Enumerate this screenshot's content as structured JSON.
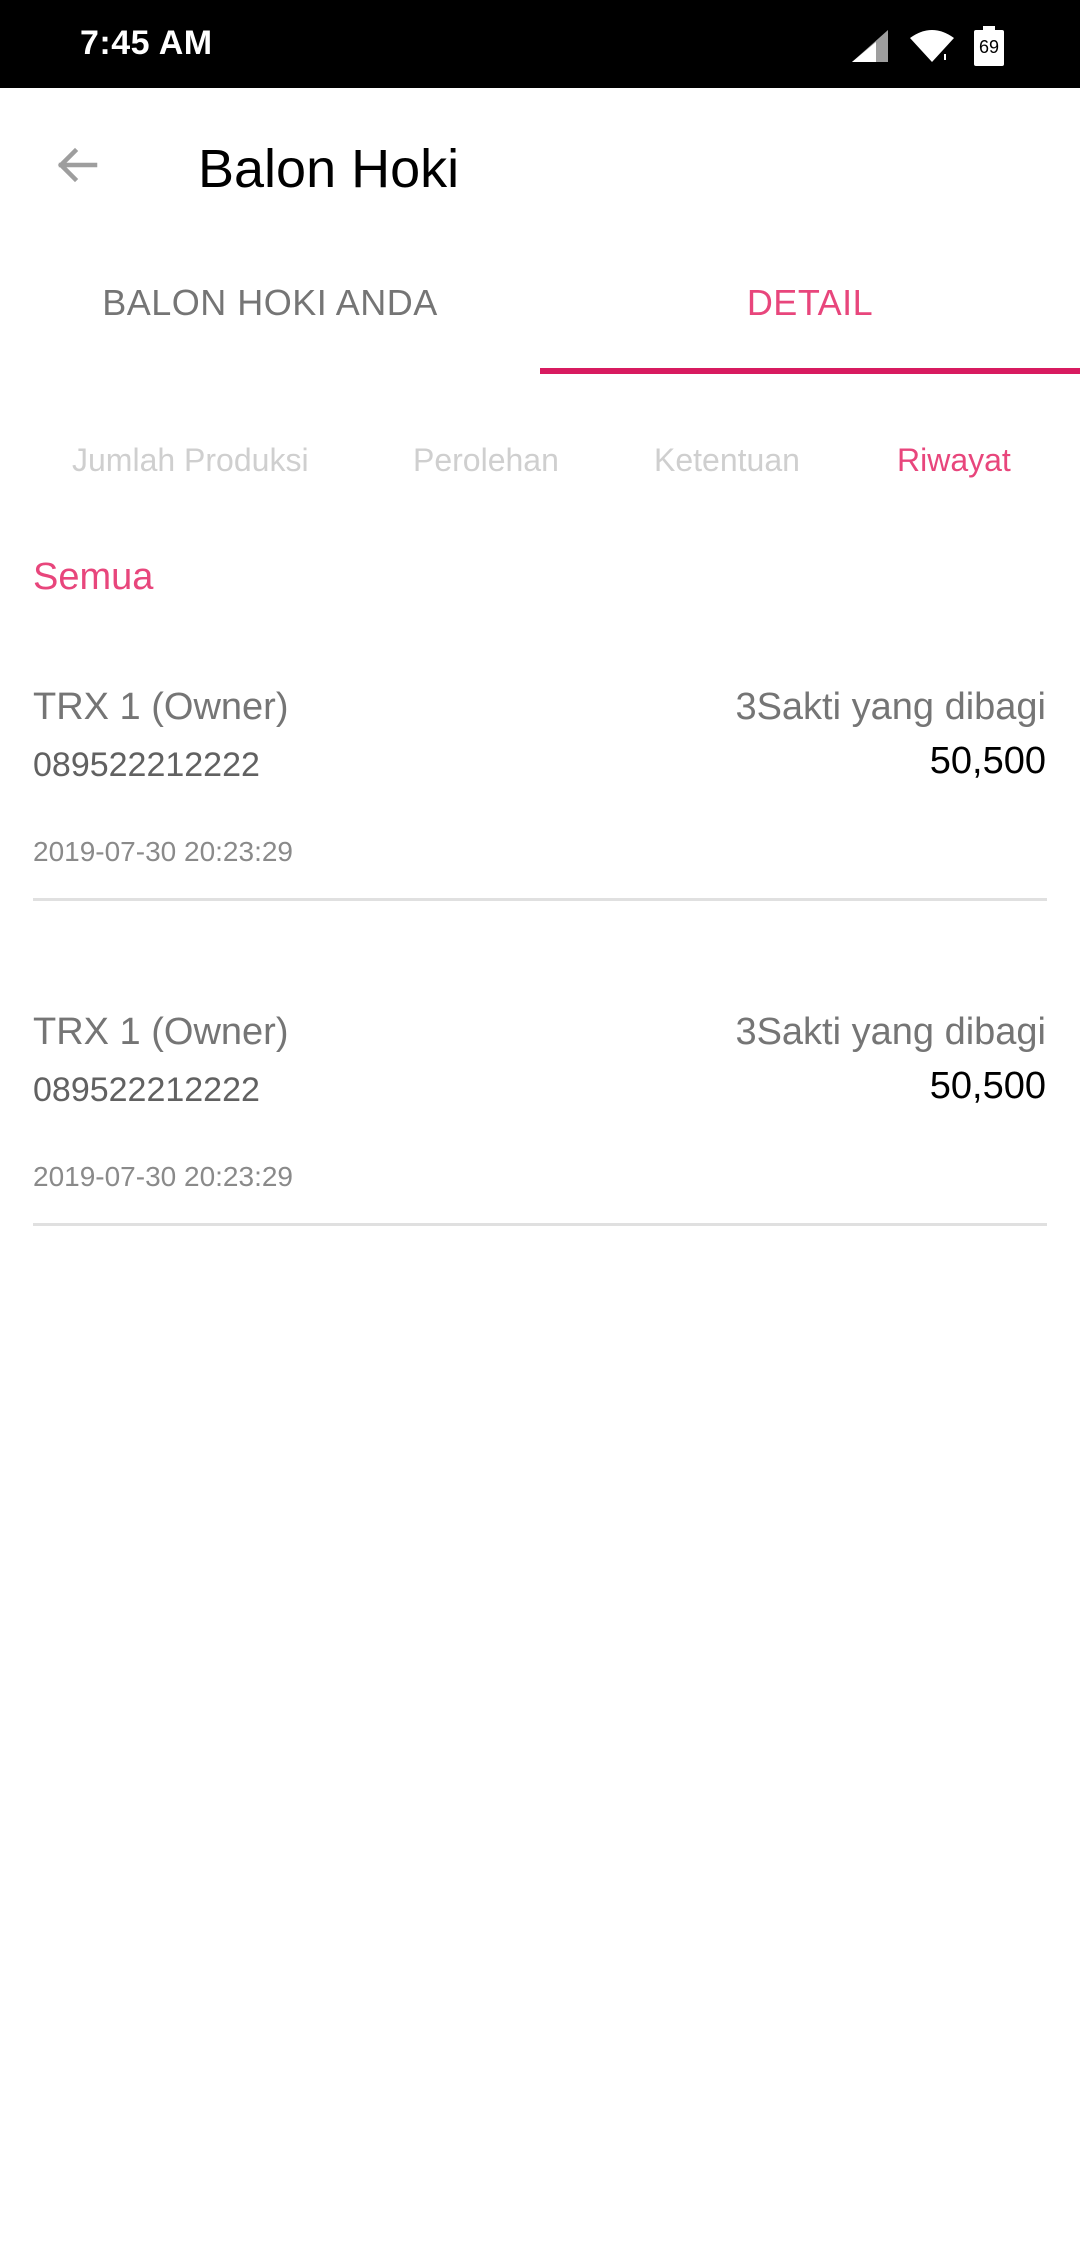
{
  "status_bar": {
    "time": "7:45 AM",
    "battery_level": "69",
    "icons": [
      "signal-icon",
      "wifi-icon",
      "battery-icon"
    ]
  },
  "app_bar": {
    "back_icon": "arrow-left-icon",
    "title": "Balon Hoki"
  },
  "main_tabs": [
    {
      "label": "BALON HOKI ANDA",
      "active": false
    },
    {
      "label": "DETAIL",
      "active": true
    }
  ],
  "sub_tabs": [
    {
      "label": "Jumlah Produksi",
      "active": false
    },
    {
      "label": "Perolehan",
      "active": false
    },
    {
      "label": "Ketentuan",
      "active": false
    },
    {
      "label": "Riwayat",
      "active": true
    }
  ],
  "filter": {
    "label": "Semua"
  },
  "history": [
    {
      "name": "TRX 1 (Owner)",
      "phone": "089522212222",
      "shared_label": "3Sakti yang dibagi",
      "amount": "50,500",
      "date": "2019-07-30 20:23:29"
    },
    {
      "name": "TRX 1 (Owner)",
      "phone": "089522212222",
      "shared_label": "3Sakti yang dibagi",
      "amount": "50,500",
      "date": "2019-07-30 20:23:29"
    }
  ],
  "colors": {
    "accent": "#e8467c",
    "indicator": "#d81b60",
    "status_bar": "#000000",
    "muted_text": "#757575",
    "inactive_subtab": "#cfcfcf"
  }
}
